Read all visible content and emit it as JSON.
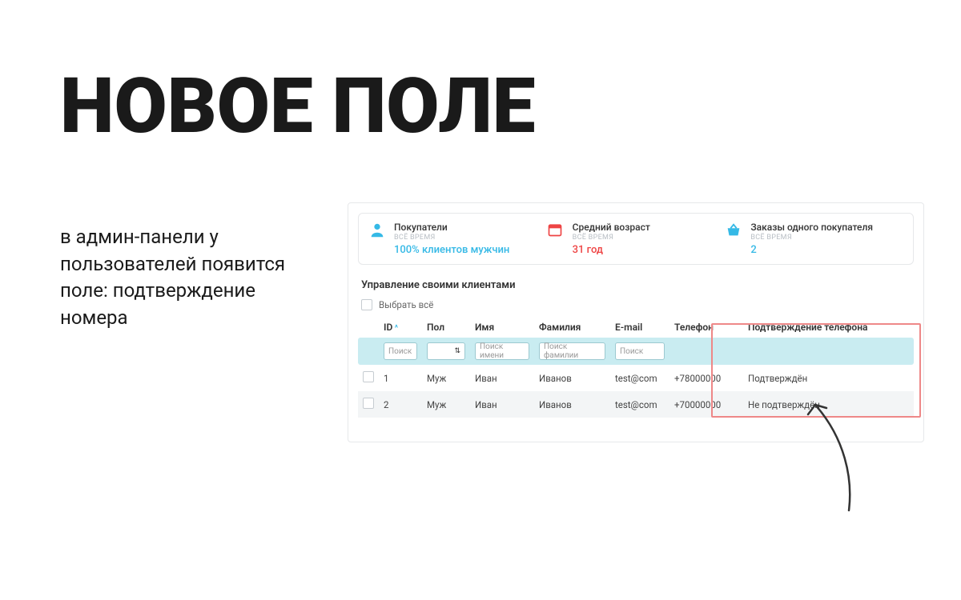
{
  "headline": "НОВОЕ ПОЛЕ",
  "subtext": "в админ-панели у пользователей появится поле: подтверждение номера",
  "stats": {
    "buyers": {
      "title": "Покупатели",
      "sub": "ВСЁ ВРЕМЯ",
      "value": "100% клиентов мужчин"
    },
    "age": {
      "title": "Средний возраст",
      "sub": "ВСЁ ВРЕМЯ",
      "value": "31 год"
    },
    "orders": {
      "title": "Заказы одного покупателя",
      "sub": "ВСЁ ВРЕМЯ",
      "value": "2"
    }
  },
  "section_title": "Управление своими клиентами",
  "select_all": "Выбрать всё",
  "columns": {
    "id": "ID",
    "gender": "Пол",
    "first": "Имя",
    "last": "Фамилия",
    "email": "E-mail",
    "phone": "Телефон",
    "confirm": "Подтверждение телефона"
  },
  "filters": {
    "id": "Поиск",
    "first": "Поиск имени",
    "last": "Поиск фамилии",
    "email": "Поиск"
  },
  "rows": [
    {
      "id": "1",
      "gender": "Муж",
      "first": "Иван",
      "last": "Иванов",
      "email": "test@com",
      "phone": "+78000000",
      "confirm": "Подтверждён"
    },
    {
      "id": "2",
      "gender": "Муж",
      "first": "Иван",
      "last": "Иванов",
      "email": "test@com",
      "phone": "+70000000",
      "confirm": "Не подтверждён"
    }
  ]
}
